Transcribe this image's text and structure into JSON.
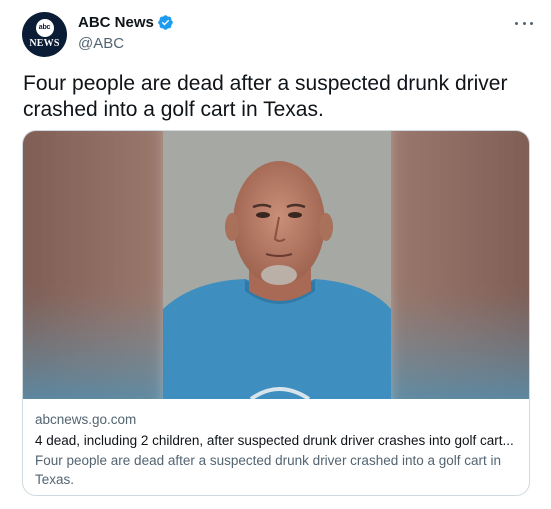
{
  "author": {
    "display_name": "ABC News",
    "handle": "@ABC",
    "verified": true,
    "avatar": {
      "logo_text": "abc",
      "logo_subtext": "NEWS"
    }
  },
  "tweet": {
    "text": "Four people are dead after a suspected drunk driver crashed into a golf cart in Texas."
  },
  "card": {
    "image_alt": "booking-photo",
    "domain": "abcnews.go.com",
    "title": "4 dead, including 2 children, after suspected drunk driver crashes into golf cart...",
    "description": "Four people are dead after a suspected drunk driver crashed into a golf cart in Texas."
  },
  "colors": {
    "verified_blue": "#1d9bf0",
    "secondary_text": "#536471",
    "primary_text": "#0f1419",
    "border": "#cfd9de",
    "avatar_bg": "#0b1d36"
  },
  "icons": {
    "more": "more-icon",
    "verified": "verified-badge-icon"
  }
}
